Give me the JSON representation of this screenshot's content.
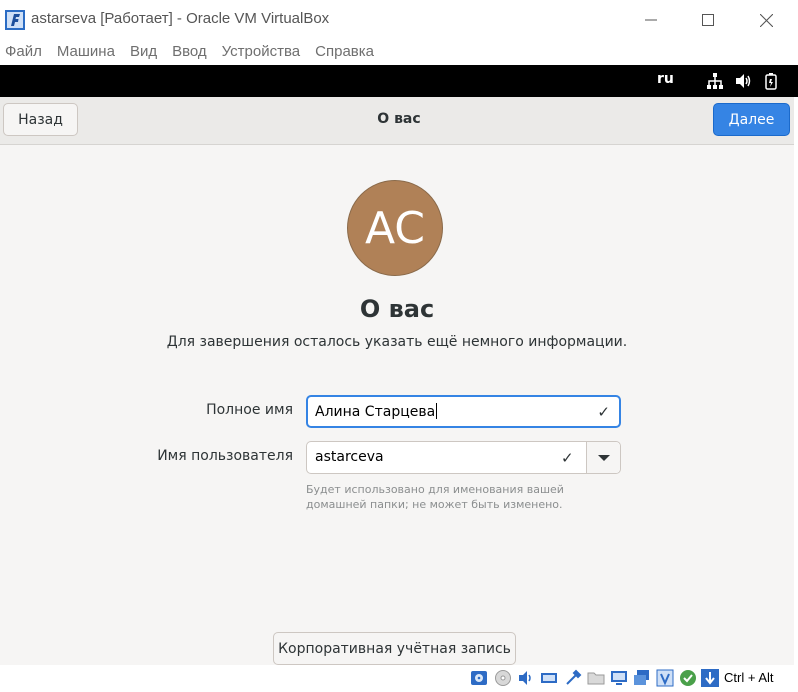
{
  "window": {
    "title": "astarseva [Работает] - Oracle VM VirtualBox"
  },
  "menu": [
    {
      "label": "Файл"
    },
    {
      "label": "Машина"
    },
    {
      "label": "Вид"
    },
    {
      "label": "Ввод"
    },
    {
      "label": "Устройства"
    },
    {
      "label": "Справка"
    }
  ],
  "guest_topbar": {
    "language": "ru",
    "icons": [
      "network-icon",
      "volume-icon",
      "battery-icon"
    ]
  },
  "header": {
    "back_label": "Назад",
    "title": "О вас",
    "next_label": "Далее"
  },
  "content": {
    "avatar_initials": "AC",
    "avatar_color": "#b08157",
    "heading": "О вас",
    "subtitle": "Для завершения осталось указать ещё немного информации.",
    "full_name": {
      "label": "Полное имя",
      "value": "Алина Старцева"
    },
    "username": {
      "label": "Имя пользователя",
      "value": "astarceva",
      "hint": "Будет использовано для именования вашей домашней папки; не может быть изменено."
    },
    "enterprise_button": "Корпоративная учётная запись"
  },
  "statusbar": {
    "host_key": "Ctrl + Alt"
  },
  "colors": {
    "accent": "#3584e4",
    "background": "#f6f5f4",
    "header": "#ebeae8"
  }
}
